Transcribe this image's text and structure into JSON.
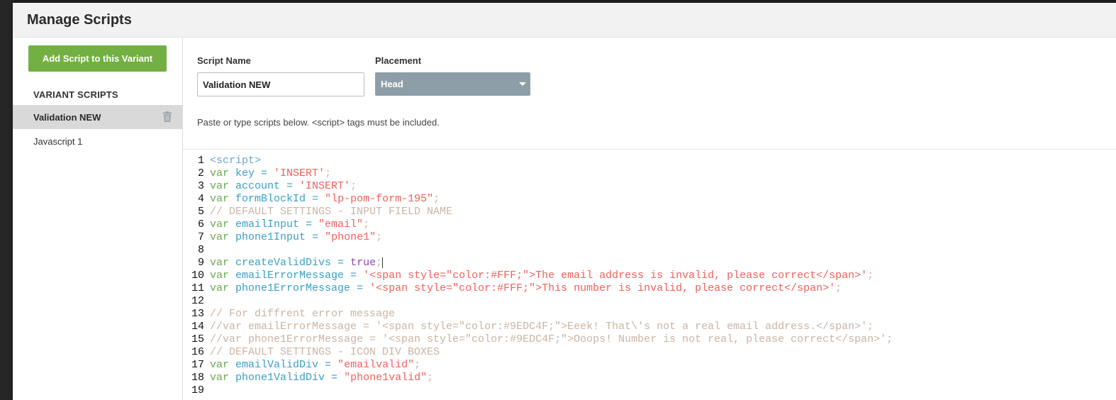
{
  "modal": {
    "title": "Manage Scripts"
  },
  "sidebar": {
    "add_button_label": "Add Script to this Variant",
    "heading": "VARIANT SCRIPTS",
    "items": [
      {
        "label": "Validation NEW",
        "active": true
      },
      {
        "label": "Javascript 1",
        "active": false
      }
    ]
  },
  "form": {
    "script_name_label": "Script Name",
    "script_name_value": "Validation NEW",
    "placement_label": "Placement",
    "placement_value": "Head",
    "hint": "Paste or type scripts below. <script> tags must be included."
  },
  "editor": {
    "line_numbers": [
      "1",
      "2",
      "3",
      "4",
      "5",
      "6",
      "7",
      "8",
      "9",
      "10",
      "11",
      "12",
      "13",
      "14",
      "15",
      "16",
      "17",
      "18",
      "19"
    ],
    "lines": [
      [
        {
          "t": "<script>",
          "c": "tg"
        }
      ],
      [
        {
          "t": "var ",
          "c": "kw"
        },
        {
          "t": "key",
          "c": "vn"
        },
        {
          "t": " = ",
          "c": "op"
        },
        {
          "t": "'INSERT'",
          "c": "st"
        },
        {
          "t": ";",
          "c": "pn"
        }
      ],
      [
        {
          "t": "var ",
          "c": "kw"
        },
        {
          "t": "account",
          "c": "vn"
        },
        {
          "t": " = ",
          "c": "op"
        },
        {
          "t": "'INSERT'",
          "c": "st"
        },
        {
          "t": ";",
          "c": "pn"
        }
      ],
      [
        {
          "t": "var ",
          "c": "kw"
        },
        {
          "t": "formBlockId",
          "c": "vn"
        },
        {
          "t": " = ",
          "c": "op"
        },
        {
          "t": "\"lp-pom-form-195\"",
          "c": "st"
        },
        {
          "t": ";",
          "c": "pn"
        }
      ],
      [
        {
          "t": "// DEFAULT SETTINGS - INPUT FIELD NAME",
          "c": "cm"
        }
      ],
      [
        {
          "t": "var ",
          "c": "kw"
        },
        {
          "t": "emailInput",
          "c": "vn"
        },
        {
          "t": " = ",
          "c": "op"
        },
        {
          "t": "\"email\"",
          "c": "st"
        },
        {
          "t": ";",
          "c": "pn"
        }
      ],
      [
        {
          "t": "var ",
          "c": "kw"
        },
        {
          "t": "phone1Input",
          "c": "vn"
        },
        {
          "t": " = ",
          "c": "op"
        },
        {
          "t": "\"phone1\"",
          "c": "st"
        },
        {
          "t": ";",
          "c": "pn"
        }
      ],
      [],
      [
        {
          "t": "var ",
          "c": "kw"
        },
        {
          "t": "createValidDivs",
          "c": "vn"
        },
        {
          "t": " = ",
          "c": "op"
        },
        {
          "t": "true",
          "c": "bl"
        },
        {
          "t": ";",
          "c": "pn"
        },
        {
          "t": "",
          "c": "cursor"
        }
      ],
      [
        {
          "t": "var ",
          "c": "kw"
        },
        {
          "t": "emailErrorMessage",
          "c": "vn"
        },
        {
          "t": " = ",
          "c": "op"
        },
        {
          "t": "'<span style=\"color:#FFF;\">The email address is invalid, please correct</span>'",
          "c": "st"
        },
        {
          "t": ";",
          "c": "pn"
        }
      ],
      [
        {
          "t": "var ",
          "c": "kw"
        },
        {
          "t": "phone1ErrorMessage",
          "c": "vn"
        },
        {
          "t": " = ",
          "c": "op"
        },
        {
          "t": "'<span style=\"color:#FFF;\">This number is invalid, please correct</span>'",
          "c": "st"
        },
        {
          "t": ";",
          "c": "pn"
        }
      ],
      [],
      [
        {
          "t": "// For diffrent error message",
          "c": "cm"
        }
      ],
      [
        {
          "t": "//var emailErrorMessage = '<span style=\"color:#9EDC4F;\">Eeek! That\\'s not a real email address.</span>';",
          "c": "cm"
        }
      ],
      [
        {
          "t": "//var phone1ErrorMessage = '<span style=\"color:#9EDC4F;\">Ooops! Number is not real, please correct</span>';",
          "c": "cm"
        }
      ],
      [
        {
          "t": "// DEFAULT SETTINGS - ICON DIV BOXES",
          "c": "cm"
        }
      ],
      [
        {
          "t": "var ",
          "c": "kw"
        },
        {
          "t": "emailValidDiv",
          "c": "vn"
        },
        {
          "t": " = ",
          "c": "op"
        },
        {
          "t": "\"emailvalid\"",
          "c": "st"
        },
        {
          "t": ";",
          "c": "pn"
        }
      ],
      [
        {
          "t": "var ",
          "c": "kw"
        },
        {
          "t": "phone1ValidDiv",
          "c": "vn"
        },
        {
          "t": " = ",
          "c": "op"
        },
        {
          "t": "\"phone1valid\"",
          "c": "st"
        },
        {
          "t": ";",
          "c": "pn"
        }
      ],
      []
    ]
  },
  "colors": {
    "add_button": "#72b043",
    "select_bg": "#8e9ea8",
    "active_item_bg": "#d9d9d9"
  }
}
